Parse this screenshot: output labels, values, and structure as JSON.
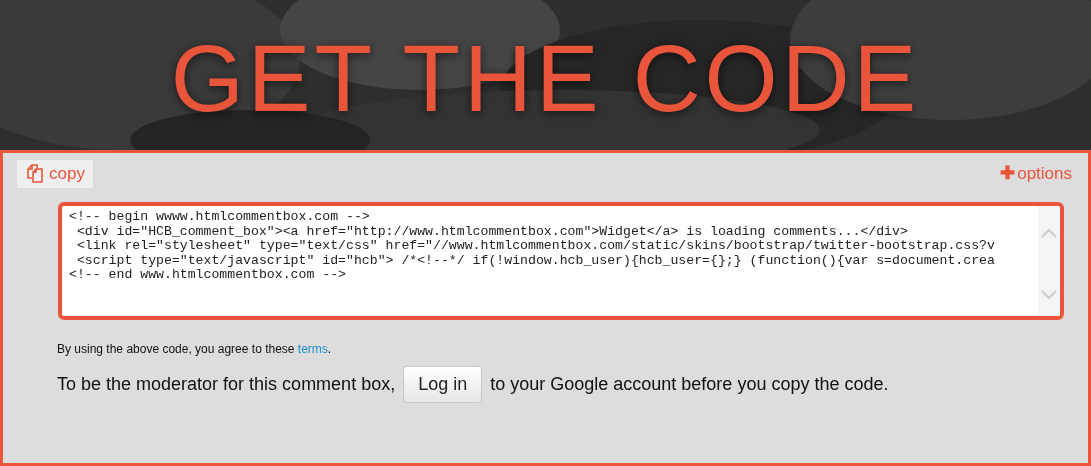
{
  "heading": "GET THE CODE",
  "toolbar": {
    "copy": "copy",
    "options_icon": "✚",
    "options": "options"
  },
  "code_lines": [
    "<!-- begin wwww.htmlcommentbox.com -->",
    " <div id=\"HCB_comment_box\"><a href=\"http://www.htmlcommentbox.com\">Widget</a> is loading comments...</div>",
    " <link rel=\"stylesheet\" type=\"text/css\" href=\"//www.htmlcommentbox.com/static/skins/bootstrap/twitter-bootstrap.css?v",
    " <script type=\"text/javascript\" id=\"hcb\"> /*<!--*/ if(!window.hcb_user){hcb_user={};} (function(){var s=document.crea",
    "<!-- end www.htmlcommentbox.com -->"
  ],
  "terms": {
    "text": "By using the above code, you agree to these",
    "link": "terms",
    "end": "."
  },
  "moderator": {
    "before": "To be the moderator for this comment box,",
    "button": "Log in",
    "after": "to your Google account before you copy the code."
  }
}
